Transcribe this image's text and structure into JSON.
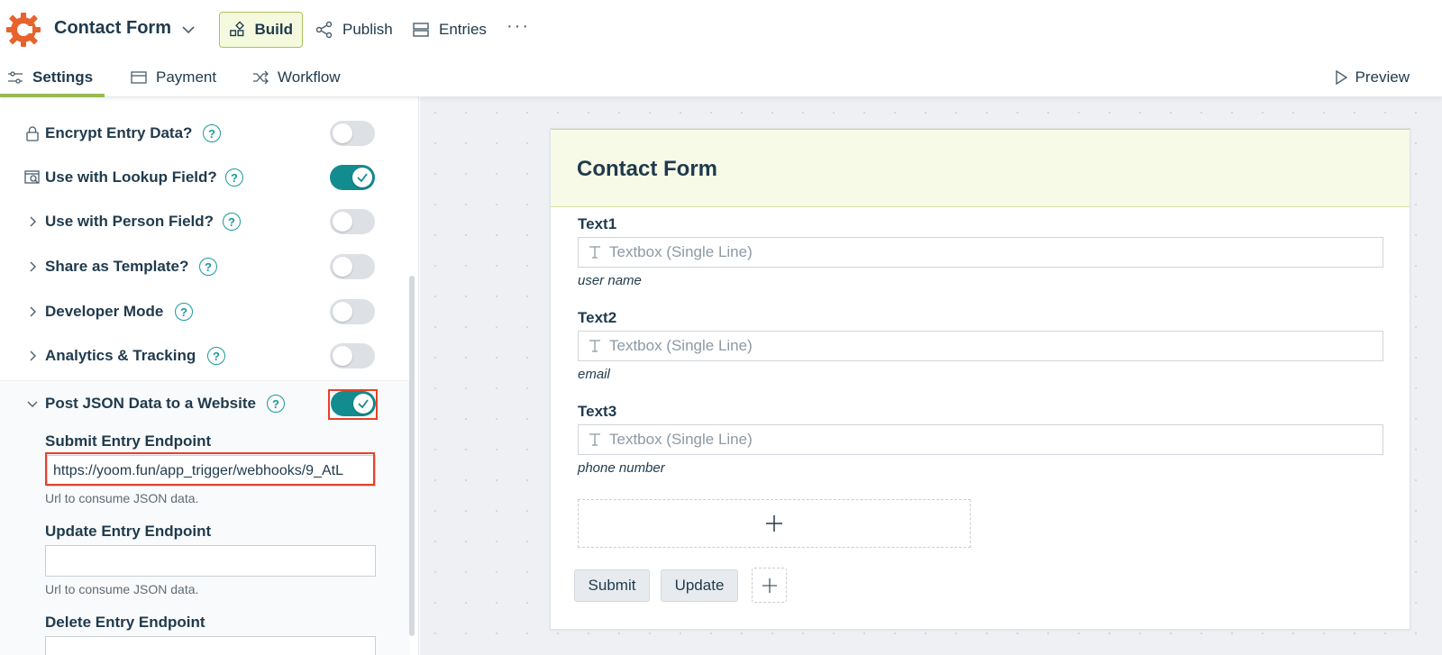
{
  "app": {
    "title": "Contact Form"
  },
  "nav": {
    "build": "Build",
    "publish": "Publish",
    "entries": "Entries",
    "more": "···"
  },
  "subtabs": {
    "settings": "Settings",
    "payment": "Payment",
    "workflow": "Workflow",
    "preview": "Preview"
  },
  "settings": {
    "toggles": [
      {
        "label": "Encrypt Entry Data?",
        "on": false,
        "icon": "lock-icon"
      },
      {
        "label": "Use with Lookup Field?",
        "on": true,
        "icon": "lookup-icon"
      },
      {
        "label": "Use with Person Field?",
        "on": false,
        "icon": "chevron-right-icon"
      },
      {
        "label": "Share as Template?",
        "on": false,
        "icon": "chevron-right-icon"
      },
      {
        "label": "Developer Mode",
        "on": false,
        "icon": "chevron-right-icon"
      },
      {
        "label": "Analytics & Tracking",
        "on": false,
        "icon": "chevron-right-icon"
      },
      {
        "label": "Post JSON Data to a Website",
        "on": true,
        "icon": "chevron-down-icon"
      }
    ],
    "submit_endpoint": {
      "label": "Submit Entry Endpoint",
      "value": "https://yoom.fun/app_trigger/webhooks/9_AtL",
      "hint": "Url to consume JSON data."
    },
    "update_endpoint": {
      "label": "Update Entry Endpoint",
      "value": "",
      "hint": "Url to consume JSON data."
    },
    "delete_endpoint": {
      "label": "Delete Entry Endpoint",
      "value": ""
    }
  },
  "form": {
    "title": "Contact Form",
    "fields": [
      {
        "label": "Text1",
        "placeholder": "Textbox (Single Line)",
        "description": "user name"
      },
      {
        "label": "Text2",
        "placeholder": "Textbox (Single Line)",
        "description": "email"
      },
      {
        "label": "Text3",
        "placeholder": "Textbox (Single Line)",
        "description": "phone number"
      }
    ],
    "buttons": {
      "submit": "Submit",
      "update": "Update"
    }
  },
  "colors": {
    "accent_teal": "#128c8f",
    "accent_green": "#9ab955",
    "brand_orange": "#e8622c",
    "highlight_red": "#e8402c"
  }
}
